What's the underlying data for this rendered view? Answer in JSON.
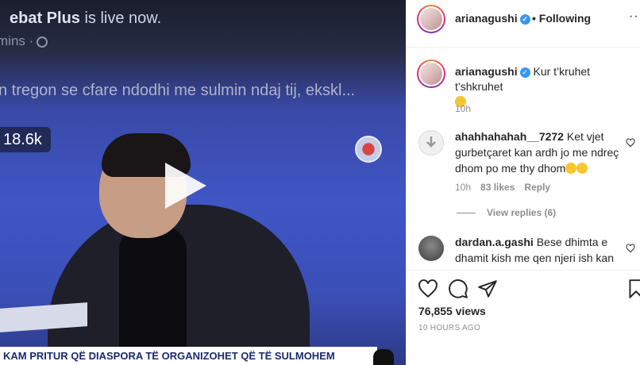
{
  "video": {
    "overlay_title_bold": "ebat Plus",
    "overlay_title_rest": " is live now.",
    "overlay_time": "mins  ·",
    "overlay_caption": "n tregon se cfare ndodhi me sulmin ndaj tij, ekskl...",
    "view_count": "18.6k",
    "ticker": "KAM PRITUR QË DIASPORA TË ORGANIZOHET QË TË SULMOHEM"
  },
  "post": {
    "author": "arianagushi",
    "following_label": "• Following",
    "more_label": "···",
    "caption_text": "Kur t’kruhet t’shkruhet",
    "caption_time": "10h",
    "views": "76,855 views",
    "posted_ago": "10 HOURS AGO"
  },
  "comments": [
    {
      "username": "ahahhahahah__7272",
      "text": "Ket vjet gurbetçaret kan ardh jo me ndreç dhom po me thy dhom",
      "time": "10h",
      "likes": "83 likes",
      "reply": "Reply",
      "view_replies": "View replies (6)"
    },
    {
      "username": "dardan.a.gashi",
      "text": "Bese dhimta e dhamit kish me qen njeri ish kan"
    }
  ],
  "colors": {
    "verified": "#3897f0",
    "muted": "#8e8e8e",
    "text": "#262626"
  }
}
